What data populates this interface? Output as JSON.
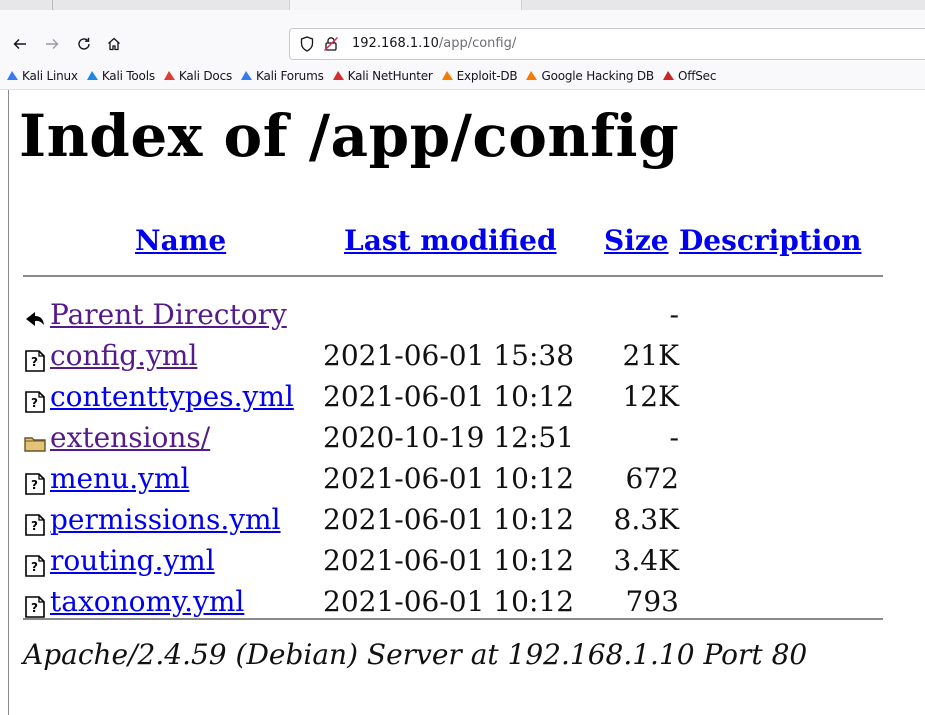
{
  "browser": {
    "url_host": "192.168.1.10",
    "url_path": "/app/config/"
  },
  "bookmarks": [
    {
      "label": "Kali Linux",
      "icon": "kali-dragon-icon",
      "color": "#367bf0"
    },
    {
      "label": "Kali Tools",
      "icon": "kali-tools-icon",
      "color": "#1e88e5"
    },
    {
      "label": "Kali Docs",
      "icon": "kali-docs-icon",
      "color": "#e53935"
    },
    {
      "label": "Kali Forums",
      "icon": "kali-forums-icon",
      "color": "#367bf0"
    },
    {
      "label": "Kali NetHunter",
      "icon": "kali-nethunter-icon",
      "color": "#d32f2f"
    },
    {
      "label": "Exploit-DB",
      "icon": "exploit-db-icon",
      "color": "#f57c00"
    },
    {
      "label": "Google Hacking DB",
      "icon": "ghdb-icon",
      "color": "#f57c00"
    },
    {
      "label": "OffSec",
      "icon": "offsec-icon",
      "color": "#c62828"
    }
  ],
  "page": {
    "title": "Index of /app/config",
    "columns": {
      "name": "Name",
      "last_modified": "Last modified",
      "size": "Size",
      "description": "Description"
    },
    "entries": [
      {
        "name": "Parent Directory",
        "date": "",
        "size": "-",
        "icon": "back-arrow-icon",
        "visited": true
      },
      {
        "name": "config.yml",
        "date": "2021-06-01 15:38",
        "size": "21K",
        "icon": "unknown-file-icon",
        "visited": true
      },
      {
        "name": "contenttypes.yml",
        "date": "2021-06-01 10:12",
        "size": "12K",
        "icon": "unknown-file-icon",
        "visited": false
      },
      {
        "name": "extensions/",
        "date": "2020-10-19 12:51",
        "size": "-",
        "icon": "folder-icon",
        "visited": true
      },
      {
        "name": "menu.yml",
        "date": "2021-06-01 10:12",
        "size": "672",
        "icon": "unknown-file-icon",
        "visited": false
      },
      {
        "name": "permissions.yml",
        "date": "2021-06-01 10:12",
        "size": "8.3K",
        "icon": "unknown-file-icon",
        "visited": false
      },
      {
        "name": "routing.yml",
        "date": "2021-06-01 10:12",
        "size": "3.4K",
        "icon": "unknown-file-icon",
        "visited": false
      },
      {
        "name": "taxonomy.yml",
        "date": "2021-06-01 10:12",
        "size": "793",
        "icon": "unknown-file-icon",
        "visited": false
      }
    ],
    "footer": "Apache/2.4.59 (Debian) Server at 192.168.1.10 Port 80"
  }
}
